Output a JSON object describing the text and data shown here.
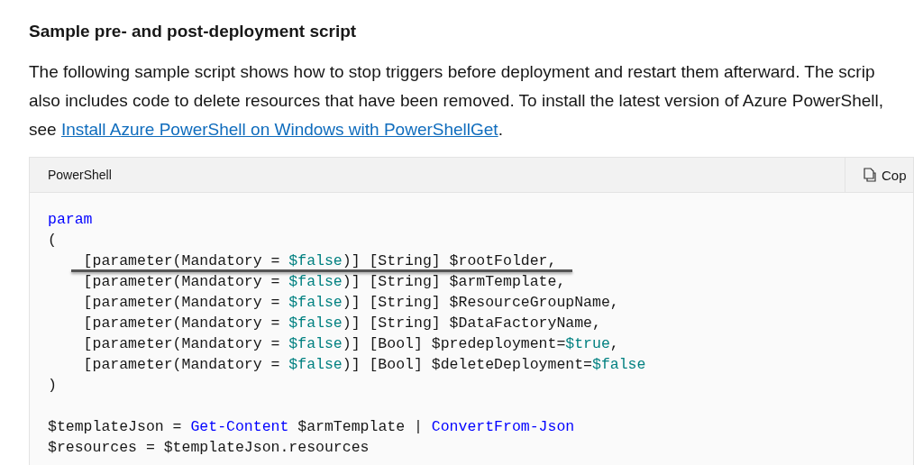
{
  "heading": "Sample pre- and post-deployment script",
  "paragraph": {
    "lines": [
      "The following sample script shows how to stop triggers before deployment and restart them afterward. The scrip",
      "also includes code to delete resources that have been removed. To install the latest version of Azure PowerShell,"
    ],
    "lead": "see ",
    "link": "Install Azure PowerShell on Windows with PowerShellGet",
    "tail": "."
  },
  "code_block": {
    "language": "PowerShell",
    "copy_label": "Cop",
    "lines": [
      {
        "struck": false,
        "tokens": [
          {
            "kind": "keyword",
            "text": "param"
          }
        ]
      },
      {
        "struck": false,
        "tokens": [
          {
            "kind": "plain",
            "text": "("
          }
        ]
      },
      {
        "struck": true,
        "tokens": [
          {
            "kind": "plain",
            "text": "    [parameter(Mandatory = "
          },
          {
            "kind": "constant",
            "text": "$false"
          },
          {
            "kind": "plain",
            "text": ")] [String] $rootFolder,"
          }
        ]
      },
      {
        "struck": false,
        "tokens": [
          {
            "kind": "plain",
            "text": "    [parameter(Mandatory = "
          },
          {
            "kind": "constant",
            "text": "$false"
          },
          {
            "kind": "plain",
            "text": ")] [String] $armTemplate,"
          }
        ]
      },
      {
        "struck": false,
        "tokens": [
          {
            "kind": "plain",
            "text": "    [parameter(Mandatory = "
          },
          {
            "kind": "constant",
            "text": "$false"
          },
          {
            "kind": "plain",
            "text": ")] [String] $ResourceGroupName,"
          }
        ]
      },
      {
        "struck": false,
        "tokens": [
          {
            "kind": "plain",
            "text": "    [parameter(Mandatory = "
          },
          {
            "kind": "constant",
            "text": "$false"
          },
          {
            "kind": "plain",
            "text": ")] [String] $DataFactoryName,"
          }
        ]
      },
      {
        "struck": false,
        "tokens": [
          {
            "kind": "plain",
            "text": "    [parameter(Mandatory = "
          },
          {
            "kind": "constant",
            "text": "$false"
          },
          {
            "kind": "plain",
            "text": ")] [Bool] $predeployment="
          },
          {
            "kind": "constant",
            "text": "$true"
          },
          {
            "kind": "plain",
            "text": ","
          }
        ]
      },
      {
        "struck": false,
        "tokens": [
          {
            "kind": "plain",
            "text": "    [parameter(Mandatory = "
          },
          {
            "kind": "constant",
            "text": "$false"
          },
          {
            "kind": "plain",
            "text": ")] [Bool] $deleteDeployment="
          },
          {
            "kind": "constant",
            "text": "$false"
          }
        ]
      },
      {
        "struck": false,
        "tokens": [
          {
            "kind": "plain",
            "text": ")"
          }
        ]
      },
      {
        "struck": false
      },
      {
        "struck": false,
        "tokens": [
          {
            "kind": "plain",
            "text": "$templateJson = "
          },
          {
            "kind": "keyword",
            "text": "Get-Content"
          },
          {
            "kind": "plain",
            "text": " $armTemplate | "
          },
          {
            "kind": "keyword",
            "text": "ConvertFrom-Json"
          }
        ]
      },
      {
        "struck": false,
        "tokens": [
          {
            "kind": "plain",
            "text": "$resources = $templateJson.resources"
          }
        ]
      }
    ]
  }
}
